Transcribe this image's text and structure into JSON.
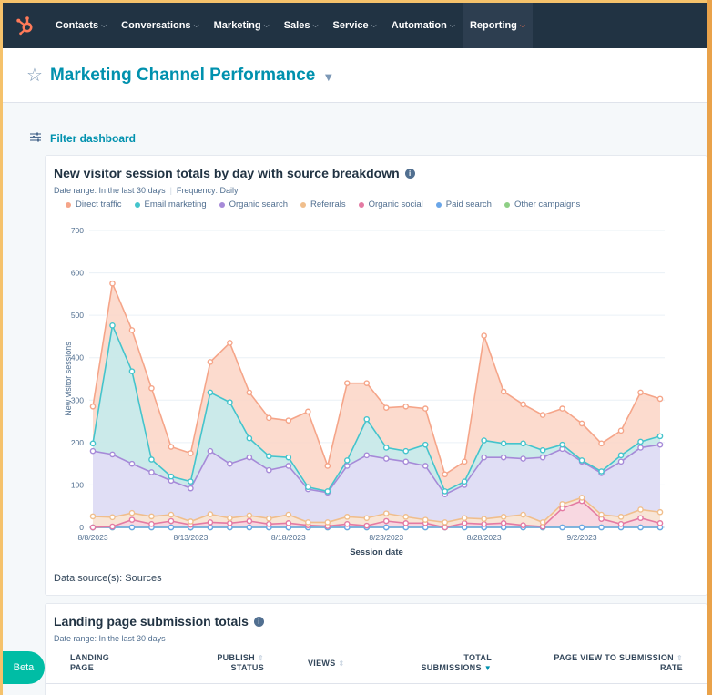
{
  "nav": {
    "items": [
      {
        "label": "Contacts",
        "active": false
      },
      {
        "label": "Conversations",
        "active": false
      },
      {
        "label": "Marketing",
        "active": false
      },
      {
        "label": "Sales",
        "active": false
      },
      {
        "label": "Service",
        "active": false
      },
      {
        "label": "Automation",
        "active": false
      },
      {
        "label": "Reporting",
        "active": true
      }
    ],
    "logo_icon": "hubspot-sprocket-icon",
    "brand_color": "#ff7a59"
  },
  "dashboard": {
    "title": "Marketing Channel Performance",
    "star_icon": "star-icon",
    "caret_icon": "caret-down-icon"
  },
  "filter": {
    "label": "Filter dashboard",
    "icon": "filter-sliders-icon"
  },
  "report1": {
    "title": "New visitor session totals by day with source breakdown",
    "date_range": "Date range: In the last 30 days",
    "frequency": "Frequency: Daily",
    "data_source": "Data source(s): Sources"
  },
  "chart_data": {
    "type": "area",
    "xlabel": "Session date",
    "ylabel": "New visitor sessions",
    "ylim": [
      0,
      700
    ],
    "yticks": [
      0,
      100,
      200,
      300,
      400,
      500,
      600,
      700
    ],
    "x": [
      "8/8/2023",
      "8/9/2023",
      "8/10/2023",
      "8/11/2023",
      "8/12/2023",
      "8/13/2023",
      "8/14/2023",
      "8/15/2023",
      "8/16/2023",
      "8/17/2023",
      "8/18/2023",
      "8/19/2023",
      "8/20/2023",
      "8/21/2023",
      "8/22/2023",
      "8/23/2023",
      "8/24/2023",
      "8/25/2023",
      "8/26/2023",
      "8/27/2023",
      "8/28/2023",
      "8/29/2023",
      "8/30/2023",
      "8/31/2023",
      "9/1/2023",
      "9/2/2023",
      "9/3/2023",
      "9/4/2023",
      "9/5/2023",
      "9/6/2023"
    ],
    "xtick_labels": [
      "8/8/2023",
      "8/13/2023",
      "8/18/2023",
      "8/23/2023",
      "8/28/2023",
      "9/2/2023"
    ],
    "legend_position": "top-left",
    "grid": true,
    "series": [
      {
        "name": "Direct traffic",
        "color": "#f5a589",
        "fill": "#fcd5c6",
        "values": [
          285,
          575,
          465,
          328,
          190,
          175,
          390,
          435,
          318,
          258,
          252,
          273,
          145,
          340,
          340,
          282,
          285,
          280,
          125,
          155,
          452,
          320,
          290,
          265,
          280,
          245,
          198,
          228,
          318,
          303
        ]
      },
      {
        "name": "Email marketing",
        "color": "#44c4cc",
        "fill": "#c2ecee",
        "values": [
          198,
          476,
          368,
          160,
          120,
          108,
          318,
          295,
          210,
          168,
          165,
          95,
          85,
          158,
          255,
          188,
          180,
          195,
          85,
          108,
          205,
          198,
          198,
          182,
          195,
          158,
          132,
          170,
          202,
          215
        ]
      },
      {
        "name": "Organic search",
        "color": "#a68ad8",
        "fill": "#e4dcf7",
        "values": [
          180,
          172,
          150,
          130,
          110,
          92,
          180,
          150,
          165,
          135,
          145,
          90,
          82,
          145,
          170,
          162,
          155,
          145,
          78,
          100,
          165,
          165,
          162,
          165,
          185,
          155,
          128,
          155,
          188,
          195
        ]
      },
      {
        "name": "Referrals",
        "color": "#f0be8c",
        "fill": "#fbe6d0",
        "values": [
          26,
          24,
          34,
          26,
          30,
          14,
          31,
          22,
          28,
          21,
          30,
          12,
          12,
          25,
          22,
          33,
          25,
          18,
          12,
          22,
          20,
          25,
          30,
          12,
          55,
          70,
          30,
          25,
          42,
          36
        ]
      },
      {
        "name": "Organic social",
        "color": "#e47aa3",
        "fill": "#f8d6e3",
        "values": [
          0,
          2,
          18,
          8,
          15,
          6,
          12,
          10,
          15,
          8,
          10,
          5,
          3,
          8,
          4,
          15,
          10,
          10,
          0,
          10,
          8,
          10,
          5,
          2,
          45,
          62,
          20,
          8,
          22,
          10
        ]
      },
      {
        "name": "Paid search",
        "color": "#6aa6e8",
        "fill": "#d7e7f8",
        "values": [
          0,
          0,
          0,
          0,
          0,
          0,
          0,
          0,
          0,
          0,
          0,
          0,
          0,
          0,
          0,
          0,
          0,
          0,
          0,
          0,
          0,
          0,
          0,
          0,
          0,
          0,
          0,
          0,
          0,
          0
        ]
      },
      {
        "name": "Other campaigns",
        "color": "#8ecf85",
        "fill": "#dbf0d7",
        "values": [
          0,
          0,
          0,
          0,
          0,
          0,
          0,
          0,
          0,
          0,
          0,
          0,
          0,
          0,
          0,
          0,
          0,
          0,
          0,
          0,
          0,
          0,
          0,
          0,
          0,
          0,
          0,
          0,
          0,
          0
        ]
      }
    ]
  },
  "report2": {
    "title": "Landing page submission totals",
    "date_range": "Date range: In the last 30 days",
    "columns": [
      {
        "label1": "LANDING",
        "label2": "PAGE"
      },
      {
        "label1": "PUBLISH",
        "label2": "STATUS"
      },
      {
        "label1": "VIEWS",
        "label2": ""
      },
      {
        "label1": "TOTAL",
        "label2": "SUBMISSIONS"
      },
      {
        "label1": "PAGE VIEW TO SUBMISSION",
        "label2": "RATE"
      }
    ]
  },
  "beta": {
    "label": "Beta"
  }
}
